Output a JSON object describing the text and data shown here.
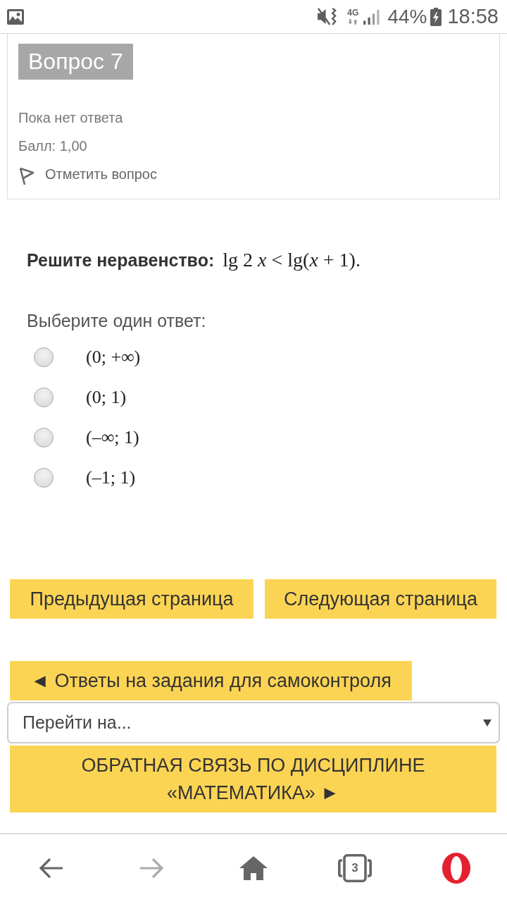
{
  "status_bar": {
    "network": "4G",
    "battery": "44%",
    "time": "18:58"
  },
  "question_info": {
    "title": "Вопрос 7",
    "state": "Пока нет ответа",
    "grade": "Балл: 1,00",
    "flag_link": "Отметить вопрос"
  },
  "question": {
    "prompt": "Решите неравенство:",
    "formula": "lg 2 *x* < lg(*x* + 1).",
    "instruction": "Выберите один ответ:",
    "options": [
      {
        "label": "(0; +∞)",
        "selected": false
      },
      {
        "label": "(0; 1)",
        "selected": false
      },
      {
        "label": "(–∞; 1)",
        "selected": false
      },
      {
        "label": "(–1; 1)",
        "selected": false
      }
    ]
  },
  "page_buttons": [
    "Предыдущая страница",
    "Следующая страница"
  ],
  "course_nav": {
    "previous_activity": "◄ Ответы на задания для самоконтроля",
    "jump_select": {
      "value": "Перейти на..."
    },
    "next_activity": "ОБРАТНАЯ СВЯЗЬ ПО ДИСЦИПЛИНЕ «МАТЕМАТИКА» ►"
  },
  "browser_toolbar": [
    {
      "kind": "back",
      "disabled": false
    },
    {
      "kind": "forward",
      "disabled": true
    },
    {
      "kind": "home",
      "disabled": false
    },
    {
      "kind": "tabs",
      "disabled": false,
      "count": "3"
    },
    {
      "kind": "menu",
      "disabled": false
    }
  ]
}
